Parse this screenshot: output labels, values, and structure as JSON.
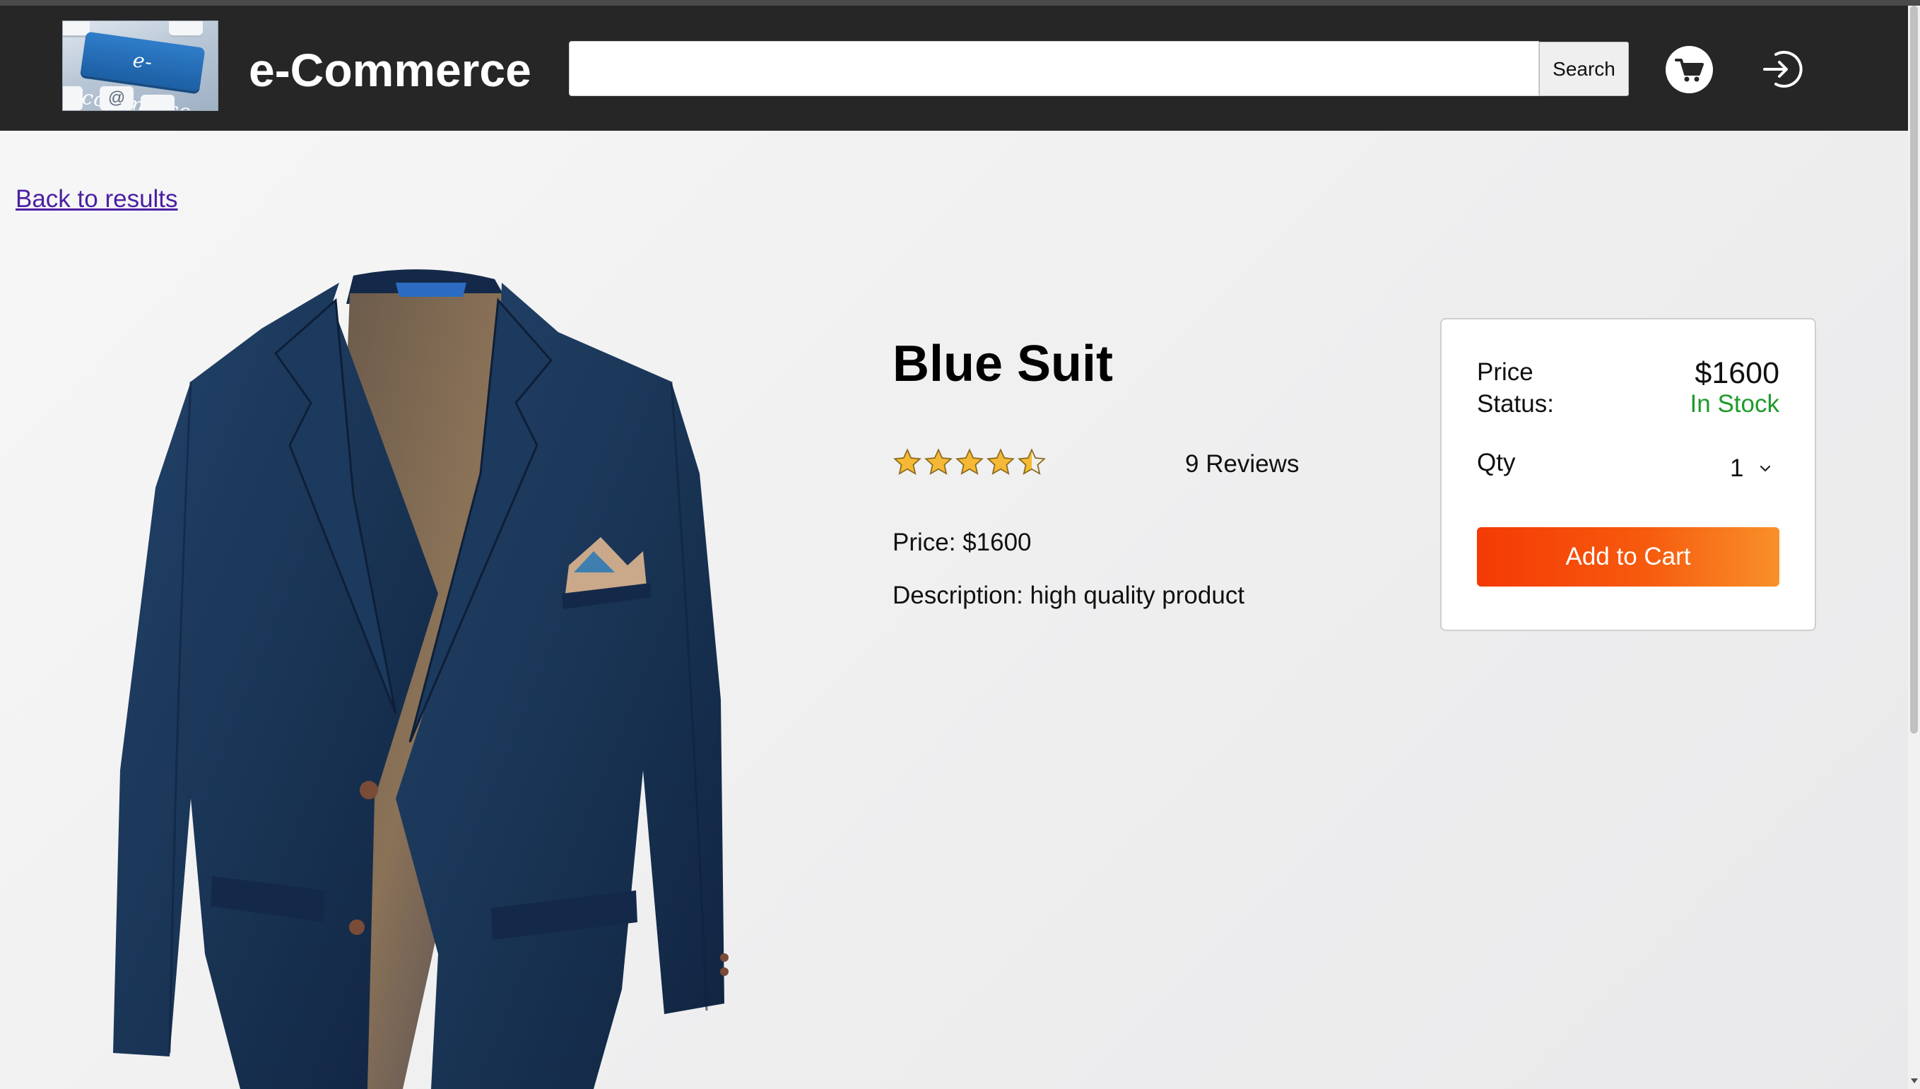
{
  "header": {
    "brand": "e-Commerce",
    "logo_text": "e-commerce",
    "logo_key_symbol": "@",
    "search": {
      "value": "",
      "placeholder": "",
      "button_label": "Search"
    },
    "icons": [
      "cart-icon",
      "login-icon"
    ]
  },
  "nav": {
    "back_link": "Back to results"
  },
  "product": {
    "title": "Blue Suit",
    "rating": 4.5,
    "rating_max": 5,
    "reviews": "9 Reviews",
    "price_text": "Price: $1600",
    "description_text": "Description: high quality product"
  },
  "cart_box": {
    "price_label": "Price",
    "price_value": "$1600",
    "status_label": "Status:",
    "status_value": "In Stock",
    "qty_label": "Qty",
    "qty_value": "1",
    "add_button": "Add to Cart"
  },
  "colors": {
    "header_bg": "#262626",
    "in_stock": "#1f9a2a",
    "add_to_cart_start": "#f43a05",
    "add_to_cart_end": "#f9902a",
    "link": "#4b1fa3",
    "star": "#f5b935"
  }
}
